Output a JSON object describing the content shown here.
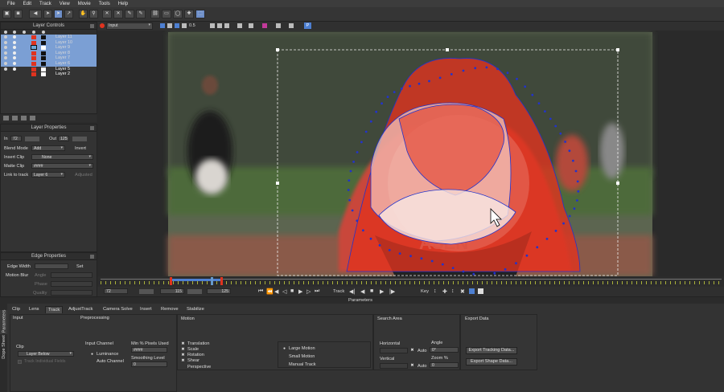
{
  "menu": [
    "File",
    "Edit",
    "Track",
    "View",
    "Movie",
    "Tools",
    "Help"
  ],
  "toolbar": {
    "input_label": "Input",
    "opacity": "0.5",
    "button_p": "P"
  },
  "layer_controls": {
    "title": "Layer Controls",
    "layers": [
      "Layer 11",
      "Layer 10",
      "Layer 9",
      "Layer 8",
      "Layer 7",
      "Layer 6",
      "Layer 5",
      "Layer 2"
    ]
  },
  "layer_properties": {
    "title": "Layer Properties",
    "in_label": "In",
    "in_value": "72",
    "out_label": "Out",
    "out_value": "125",
    "blend_mode_label": "Blend Mode",
    "blend_mode_value": "Add",
    "invert_label": "Invert",
    "insert_clip_label": "Insert Clip",
    "insert_clip_value": "None",
    "matte_clip_label": "Matte Clip",
    "matte_clip_value": "####",
    "link_to_track_label": "Link to track",
    "link_to_track_value": "Layer 6",
    "adjusted_label": "Adjusted"
  },
  "edge_properties": {
    "title": "Edge Properties",
    "edge_width_label": "Edge Width",
    "set_label": "Set",
    "motion_blur_label": "Motion Blur",
    "angle_label": "Angle",
    "phase_label": "Phase",
    "quality_label": "Quality"
  },
  "timeline": {
    "start": "72",
    "current": "115",
    "end": "125",
    "track_label": "Track",
    "key_label": "Key"
  },
  "parameters": {
    "title": "Parameters",
    "side_tabs": [
      "Parameters",
      "Dope Sheet"
    ],
    "tabs": [
      "Clip",
      "Lens",
      "Track",
      "AdjustTrack",
      "Camera Solve",
      "Insert",
      "Remove",
      "Stabilize"
    ],
    "input": {
      "title": "Input",
      "clip_label": "Clip",
      "clip_value": "Layer Below",
      "track_individual_fields": "Track Individual Fields"
    },
    "preprocessing": {
      "title": "Preprocessing",
      "input_channel_label": "Input Channel",
      "luminance": "Luminance",
      "auto_channel": "Auto Channel",
      "min_pixels_label": "Min % Pixels Used",
      "min_pixels_value": "####",
      "smoothing_label": "Smoothing Level",
      "smoothing_value": "0"
    },
    "motion": {
      "title": "Motion",
      "options": [
        "Translation",
        "Scale",
        "Rotation",
        "Shear",
        "Perspective"
      ],
      "modes": [
        "Large Motion",
        "Small Motion",
        "Manual Track"
      ]
    },
    "search_area": {
      "title": "Search Area",
      "horizontal_label": "Horizontal",
      "vertical_label": "Vertical",
      "auto1": "Auto",
      "auto2": "Auto",
      "angle_label": "Angle",
      "angle_value": "0°",
      "zoom_label": "Zoom %",
      "zoom_value": "0"
    },
    "export_data": {
      "title": "Export Data",
      "export_tracking": "Export Tracking Data...",
      "export_shape": "Export Shape Data..."
    }
  },
  "colors": {
    "selection": "#7b9fd4",
    "accent_blue": "#4d7fd1",
    "spline": "#2233cc",
    "red_layer": "#e0331f"
  }
}
